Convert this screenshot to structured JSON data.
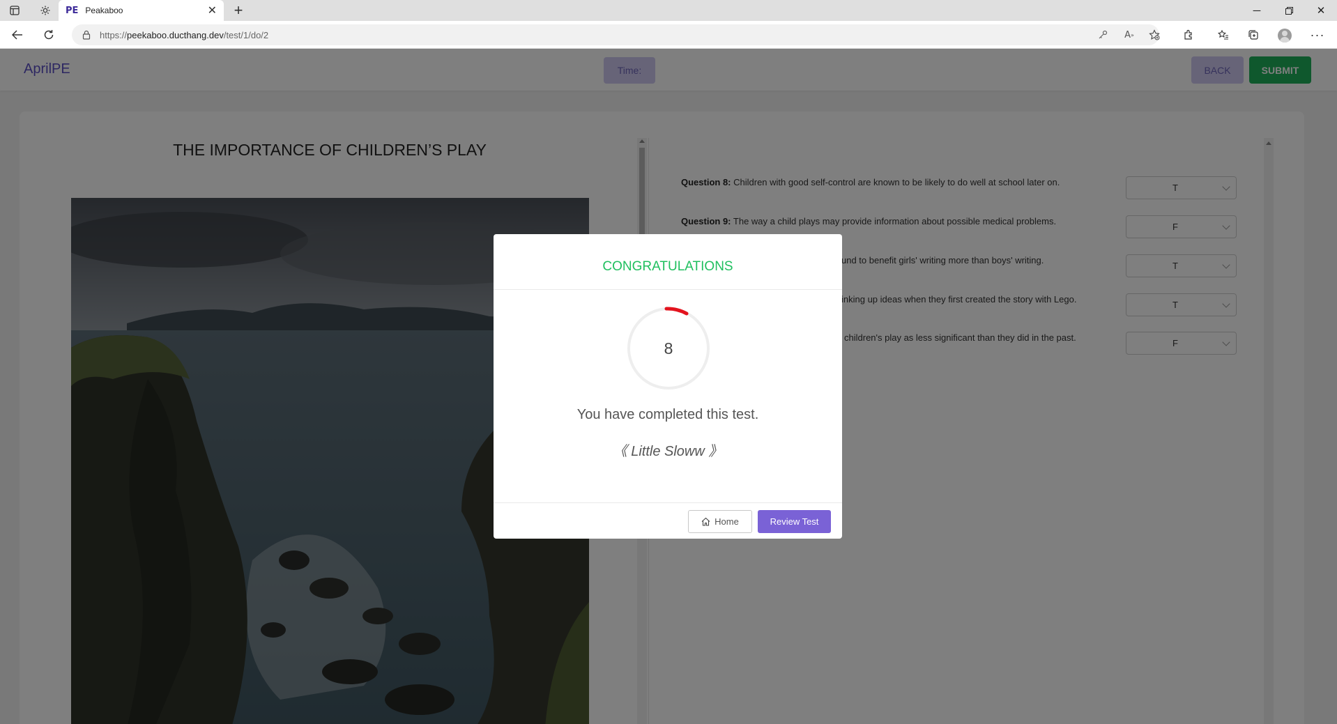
{
  "browser": {
    "tab": {
      "favicon_text": "PE",
      "title": "Peakaboo"
    },
    "url": {
      "scheme": "https://",
      "host": "peekaboo.ducthang.dev",
      "path": "/test/1/do/2"
    }
  },
  "header": {
    "brand": "AprilPE",
    "timer_label": "Time:",
    "back_label": "BACK",
    "submit_label": "SUBMIT"
  },
  "passage": {
    "title": "THE IMPORTANCE OF CHILDREN’S PLAY",
    "image": "coastal cliffs photo"
  },
  "questions": [
    {
      "label": "Question 8:",
      "text": " Children with good self-control are known to be likely to do well at school later on.",
      "answer": "T"
    },
    {
      "label": "Question 9:",
      "text": " The way a child plays may provide information about possible medical problems.",
      "answer": "F"
    },
    {
      "label": "",
      "text": "und to benefit girls' writing more than boys' writing.",
      "answer": "T"
    },
    {
      "label": "",
      "text": "inking up ideas when they first created the story with Lego.",
      "answer": "T"
    },
    {
      "label": "",
      "text": "children's play as less significant than they did in the past.",
      "answer": "F"
    }
  ],
  "modal": {
    "title": "CONGRATULATIONS",
    "score": "8",
    "message": "You have completed this test.",
    "rank": "《 Little Sloww 》",
    "home_label": "Home",
    "review_label": "Review Test",
    "progress_color": "#e3131e",
    "accent_color": "#1fbf5e"
  }
}
